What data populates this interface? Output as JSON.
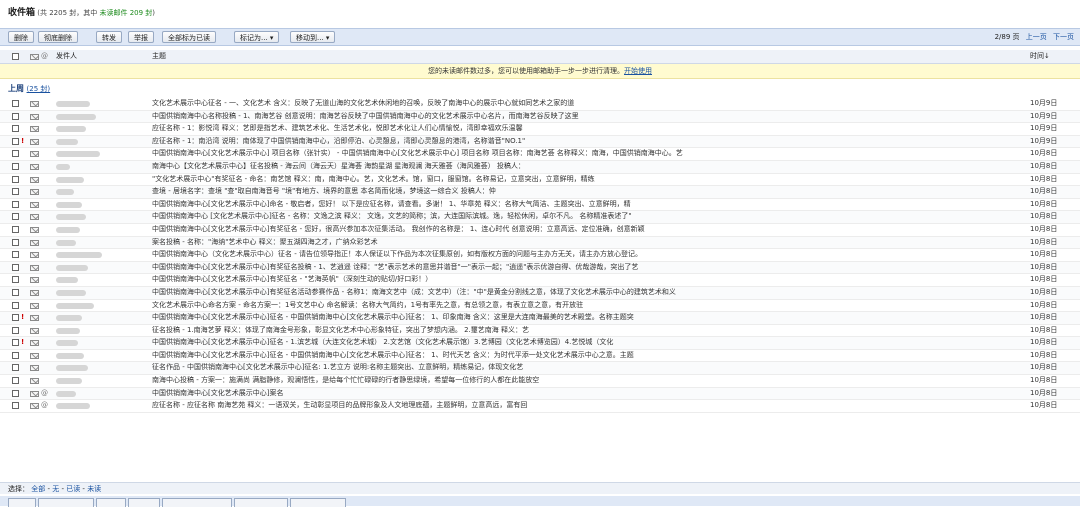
{
  "title": "收件箱",
  "count_text": "(共 2205 封，其中 ",
  "unread_text": "未读邮件 209 封",
  "count_end": ")",
  "toolbar": {
    "delete": "删除",
    "permanent_delete": "彻底删除",
    "forward": "转发",
    "report": "举报",
    "mark_all_read": "全部标为已读",
    "mark_as": "标记为... ▾",
    "move_to": "移动到... ▾"
  },
  "pager": {
    "page": "2/89 页",
    "prev": "上一页",
    "next": "下一页"
  },
  "columns": {
    "sender": "发件人",
    "subject": "主题",
    "time": "时间↓"
  },
  "notice": {
    "text": "您的未读邮件数过多，您可以使用邮箱助手一步一步进行清理。",
    "link": "开始使用"
  },
  "group": {
    "label": "上周",
    "count": "(25 封)"
  },
  "rows": [
    {
      "subject": "文化艺术展示中心征名 - 一、文化艺术 含义：反映了无道山海的文化艺术休闲地的召唤，反映了南海中心的展示中心就如同艺术之家的道",
      "date": "10月9日",
      "flag": false
    },
    {
      "subject": "中国供销南海中心名称投稿 - 1、南海艺谷 创意说明：南海艺谷反映了中国供销南海中心的文化艺术展示中心名片，而南海艺谷反映了这里",
      "date": "10月9日",
      "flag": false
    },
    {
      "subject": "应征名称 - 1：影悦湾 释义：艺即是指艺术、建筑艺术化、生活艺术化，悦即艺术化让人们心情愉悦，湾即幸福欢乐温馨",
      "date": "10月9日",
      "flag": false
    },
    {
      "subject": "应征名称 - 1：南沿湾 说明：南体现了中国供销南海中心，沿即停泊、心灵憩息，湾即心灵憩息的港湾，名称谐音\"NO.1\"",
      "date": "10月9日",
      "flag": true
    },
    {
      "subject": "中国供销南海中心[文化艺术展示中心] 项目名称（张针实） - 中国供销南海中心[文化艺术展示中心] 项目名称 项目名称：南海艺荟 名称释义：南海，中国供销南海中心。艺",
      "date": "10月8日",
      "flag": false
    },
    {
      "subject": "南海中心【文化艺术展示中心】征名投稿 - 海云间（海云天）星海荟 海韵星湖 星海观澜 海天雅荟（海风雅荟） 投稿人：",
      "date": "10月8日",
      "flag": false
    },
    {
      "subject": "\"文化艺术展示中心\"有奖征名 - 命名：南艺馆 释义：南，南海中心。艺，文化艺术。馆，窗口，服窗馆。名称易记，立意突出，立意鲜明，精练",
      "date": "10月8日",
      "flag": false
    },
    {
      "subject": "查境 - 居境名字：查境 \"查\"取自南海音号 \"境\"有地方、境界的意思 本名简而化境，梦境这一综合义 投稿人：仲",
      "date": "10月8日",
      "flag": false
    },
    {
      "subject": "中国供销南海中心[文化艺术展示中心]命名 - 敬启者，您好！ 以下是应征名称，请查看。多谢！ 1、华章苑 释义：名称大气简洁、主题突出、立意鲜明，精",
      "date": "10月8日",
      "flag": false
    },
    {
      "subject": "中国供销南海中心 [文化艺术展示中心]征名 - 名称：文逸之滨 释义： 文逸，文艺的简称；滨，大连国际滨城。逸，轻松休闲，卓尔不凡。 名称精准表述了\"",
      "date": "10月8日",
      "flag": false
    },
    {
      "subject": "中国供销南海中心[文化艺术展示中心]有奖征名 - 您好，很高兴参加本次征集活动。 我创作的名称是： 1、连心时代 创意说明：立意高远、定位准确，创意新颖",
      "date": "10月8日",
      "flag": false
    },
    {
      "subject": "案名投稿 - 名称：\"海纳\"艺术中心 释义：聚五湖四海之才，广纳众彩艺术",
      "date": "10月8日",
      "flag": false
    },
    {
      "subject": "中国供销南海中心（文化艺术展示中心）征名 - 请告位领导指正！本人保证以下作品为本次征集原创，如有版权方面的问题与主办方无关，请主办方放心登记。",
      "date": "10月8日",
      "flag": false
    },
    {
      "subject": "中国供销南海中心[文化艺术展示中心]有奖征名投稿 - 1、艺逍遥 诠释：\"艺\"表示艺术的意思并谐音\"一\"表示一起；\"逍遥\"表示优游自得、优哉游哉，突出了艺",
      "date": "10月8日",
      "flag": false
    },
    {
      "subject": "中国供销南海中心[文化艺术展示中心]有奖征名 - \"艺海英帆\"（深刻生动的贴切/好口彩！）",
      "date": "10月8日",
      "flag": false
    },
    {
      "subject": "中国供销南海中心[文化艺术展示中心]有奖征名活动参赛作品 - 名称1：南海文艺中（成：文艺中）（注：\"中\"是黄金分割线之意，体现了文化艺术展示中心的建筑艺术和义",
      "date": "10月8日",
      "flag": false
    },
    {
      "subject": "文化艺术展示中心命名方案 - 命名方案一：1号文艺中心 命名解读：名称大气简约，1号有率先之意，有总领之意，有表立意之意，有开放驻",
      "date": "10月8日",
      "flag": false
    },
    {
      "subject": "中国供销南海中心[文化艺术展示中心]征名 - 中国供销南海中心[文化艺术展示中心]征名： 1、印象南海 含义：这里是大连南海最美的艺术殿堂。名称主题突",
      "date": "10月8日",
      "flag": true
    },
    {
      "subject": "征名投稿 - 1.南海艺萝 释义：体现了南海金号形象，彰显文化艺术中心形象特征，突出了梦想内涵。 2.璽艺南海 释义：艺",
      "date": "10月8日",
      "flag": false
    },
    {
      "subject": "中国供销南海中心[文化艺术展示中心]征名 - 1.滨艺城（大连文化艺术城） 2.文艺馆（文化艺术展示馆）3.艺博园（文化艺术博览园）4.艺悦城（文化",
      "date": "10月8日",
      "flag": true
    },
    {
      "subject": "中国供销南海中心[文化艺术展示中心]征名 - 中国供销南海中心[文化艺术展示中心]征名： 1、时代天艺 含义：为时代平添一处文化艺术展示中心之意。主题",
      "date": "10月8日",
      "flag": false
    },
    {
      "subject": "征名作品 - 中国供销南海中心[文化艺术展示中心]征名: 1.艺立方 说明:名称主题突出、立意鲜明，精练易记，体现文化艺",
      "date": "10月8日",
      "flag": false
    },
    {
      "subject": "南海中心投稿 - 方案一：施满尚 满脂静修，观澜悟性，是给每个忙忙碌碌的行者静思绿境，希望每一位修行的人都在此能放空",
      "date": "10月8日",
      "flag": false
    },
    {
      "subject": "中国供销南海中心[文化艺术展示中心]案名",
      "date": "10月8日",
      "flag": false,
      "clip": true
    },
    {
      "subject": "应征名称 - 应征名称 南海艺苑 释义：一语双关，生动彰显项目的品牌形象及人文地理底蕴，主题鲜明，立意高远，富有回",
      "date": "10月8日",
      "flag": false,
      "clip": true
    }
  ],
  "footer": {
    "label": "选择：",
    "all": "全部",
    "none": "无",
    "read": "已读",
    "unread": "未读"
  }
}
